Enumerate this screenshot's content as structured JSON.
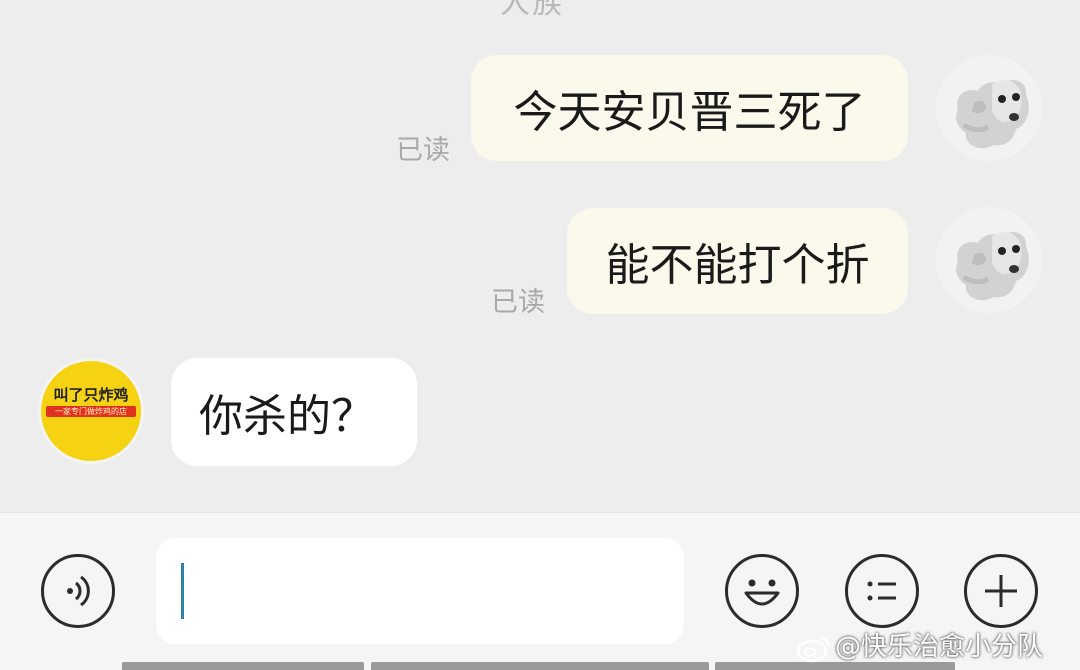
{
  "chat": {
    "partial_header_text": "人族",
    "messages": [
      {
        "direction": "outgoing",
        "text": "今天安贝晋三死了",
        "status": "已读",
        "avatar": "dog-icon"
      },
      {
        "direction": "outgoing",
        "text": "能不能打个折",
        "status": "已读",
        "avatar": "dog-icon"
      },
      {
        "direction": "incoming",
        "text": "你杀的？",
        "avatar": "fried-chicken-shop-logo"
      }
    ],
    "shop_logo": {
      "name": "叫了只炸鸡",
      "tagline": "一家专门做炸鸡的店",
      "color": "#f5d312",
      "accent": "#e0301e"
    }
  },
  "input_bar": {
    "voice_icon": "voice-icon",
    "input_value": "",
    "emoji_icon": "smiley-icon",
    "menu_icon": "list-icon",
    "plus_icon": "plus-icon"
  },
  "watermark": {
    "text": "@快乐治愈小分队",
    "icon": "weibo-icon"
  },
  "colors": {
    "background": "#ededed",
    "outgoing_bubble": "#fbf8ec",
    "incoming_bubble": "#ffffff",
    "caret": "#2f7fa7"
  }
}
